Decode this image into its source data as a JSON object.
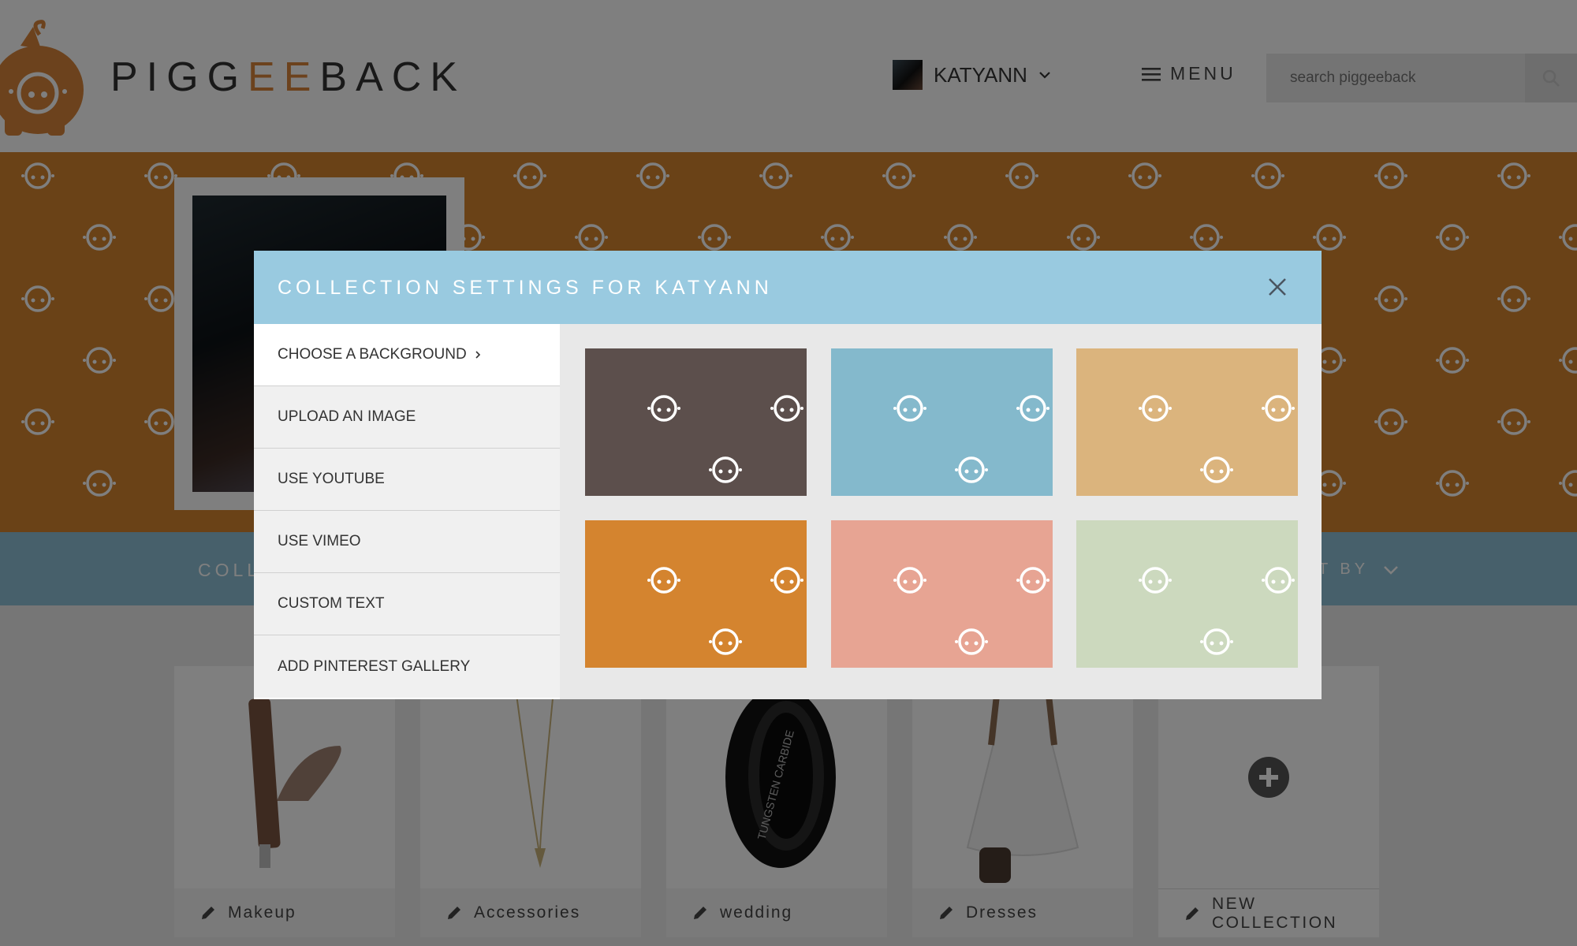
{
  "header": {
    "logo_text_start": "PIGG",
    "logo_text_accent": "EE",
    "logo_text_end": "BACK",
    "user_name": "KATYANN",
    "menu_label": "MENU",
    "search_placeholder": "search piggeeback",
    "brand_color": "#d8853a"
  },
  "collections_bar": {
    "collections_label": "COLL",
    "sort_label": "T BY"
  },
  "cards": [
    {
      "label": "Makeup"
    },
    {
      "label": "Accessories"
    },
    {
      "label": "wedding"
    },
    {
      "label": "Dresses"
    },
    {
      "label": "NEW COLLECTION"
    }
  ],
  "modal": {
    "title": "COLLECTION SETTINGS FOR KATYANN",
    "options": [
      {
        "label": "CHOOSE A BACKGROUND"
      },
      {
        "label": "UPLOAD AN IMAGE"
      },
      {
        "label": "USE YOUTUBE"
      },
      {
        "label": "USE VIMEO"
      },
      {
        "label": "CUSTOM TEXT"
      },
      {
        "label": "ADD PINTEREST GALLERY"
      }
    ],
    "swatches": [
      {
        "color": "#5c4f4c"
      },
      {
        "color": "#84b9cc"
      },
      {
        "color": "#dbb47d"
      },
      {
        "color": "#d4842f"
      },
      {
        "color": "#e7a493"
      },
      {
        "color": "#ccd9be"
      }
    ]
  }
}
